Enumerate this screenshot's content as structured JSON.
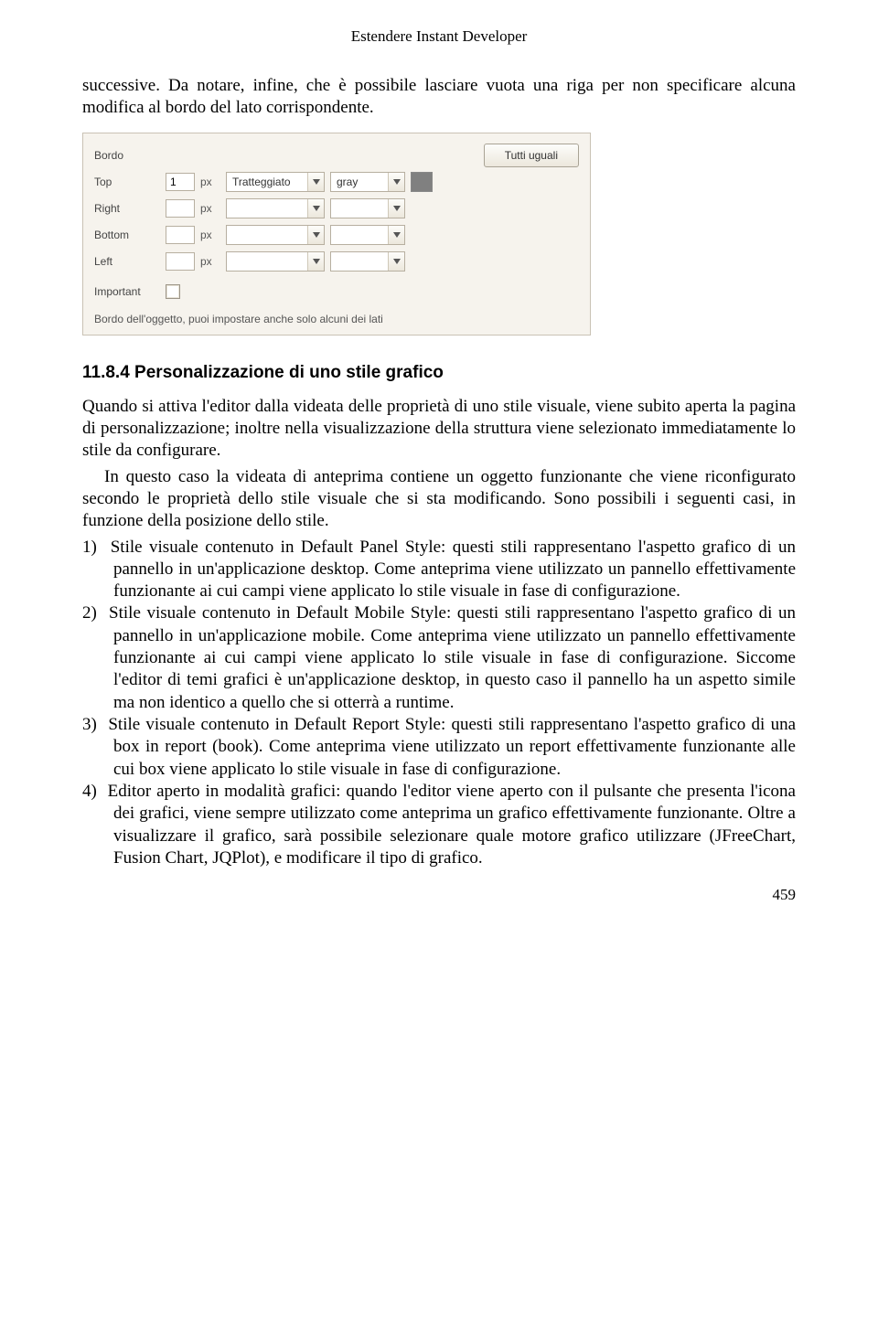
{
  "running_head": "Estendere Instant Developer",
  "intro": "successive. Da notare, infine, che è possibile lasciare vuota una riga per non specificare alcuna modifica al bordo del lato corrispondente.",
  "panel": {
    "title": "Bordo",
    "button_all_equal": "Tutti uguali",
    "rows": [
      {
        "label": "Top",
        "value": "1",
        "unit": "px",
        "style": "Tratteggiato",
        "color": "gray"
      },
      {
        "label": "Right",
        "value": "",
        "unit": "px",
        "style": "",
        "color": ""
      },
      {
        "label": "Bottom",
        "value": "",
        "unit": "px",
        "style": "",
        "color": ""
      },
      {
        "label": "Left",
        "value": "",
        "unit": "px",
        "style": "",
        "color": ""
      }
    ],
    "important_label": "Important",
    "hint": "Bordo dell'oggetto, puoi impostare anche solo alcuni dei lati",
    "swatch_color": "#808080"
  },
  "heading": "11.8.4 Personalizzazione di uno stile grafico",
  "p1": "Quando si attiva l'editor dalla videata delle proprietà di uno stile visuale, viene subito aperta la pagina di personalizzazione; inoltre nella visualizzazione della struttura viene selezionato immediatamente lo stile da configurare.",
  "p2": "In questo caso la videata di anteprima contiene un oggetto funzionante che viene riconfigurato secondo le proprietà dello stile visuale che si sta modificando. Sono possibili i seguenti casi, in funzione della posizione dello stile.",
  "list": [
    {
      "n": "1)",
      "t": "Stile visuale contenuto in Default Panel Style: questi stili rappresentano l'aspetto grafico di un pannello in un'applicazione desktop. Come anteprima viene utilizzato un pannello effettivamente funzionante ai cui campi viene applicato lo stile visuale in fase di configurazione."
    },
    {
      "n": "2)",
      "t": "Stile visuale contenuto in Default Mobile Style: questi stili rappresentano l'aspetto grafico di un pannello in un'applicazione mobile. Come anteprima viene utilizzato un pannello effettivamente funzionante ai cui campi viene applicato lo stile visuale in fase di configurazione. Siccome l'editor di temi grafici è un'applicazione desktop, in questo caso il pannello ha un aspetto simile ma non identico a quello che si otterrà a runtime."
    },
    {
      "n": "3)",
      "t": "Stile visuale contenuto in Default Report Style: questi stili rappresentano l'aspetto grafico di una box in report (book). Come anteprima viene utilizzato un report effettivamente funzionante alle cui box viene applicato lo stile visuale in fase di configurazione."
    },
    {
      "n": "4)",
      "t": "Editor aperto in modalità grafici: quando l'editor viene aperto con il pulsante che presenta l'icona dei grafici, viene sempre utilizzato come anteprima un grafico effettivamente funzionante. Oltre a visualizzare il grafico, sarà possibile selezionare quale motore grafico utilizzare (JFreeChart, Fusion Chart, JQPlot), e modificare il tipo di grafico."
    }
  ],
  "page_number": "459"
}
